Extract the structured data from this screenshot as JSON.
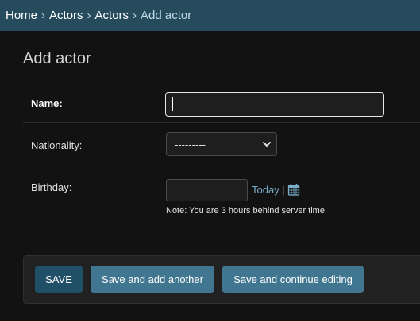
{
  "breadcrumbs": [
    {
      "label": "Home"
    },
    {
      "label": "Actors"
    },
    {
      "label": "Actors"
    }
  ],
  "breadcrumb_separator": "›",
  "breadcrumb_current": "Add actor",
  "page_title": "Add actor",
  "form": {
    "name": {
      "label": "Name:",
      "value": ""
    },
    "nationality": {
      "label": "Nationality:",
      "selected": "---------"
    },
    "birthday": {
      "label": "Birthday:",
      "value": "",
      "today_link": "Today",
      "separator": "|",
      "note": "Note: You are 3 hours behind server time."
    }
  },
  "buttons": {
    "save": "SAVE",
    "save_add_another": "Save and add another",
    "save_continue": "Save and continue editing"
  },
  "colors": {
    "header_bg": "#264b5d",
    "link": "#79aec8",
    "button_primary": "#205067",
    "button": "#417690",
    "page_bg": "#121212"
  }
}
